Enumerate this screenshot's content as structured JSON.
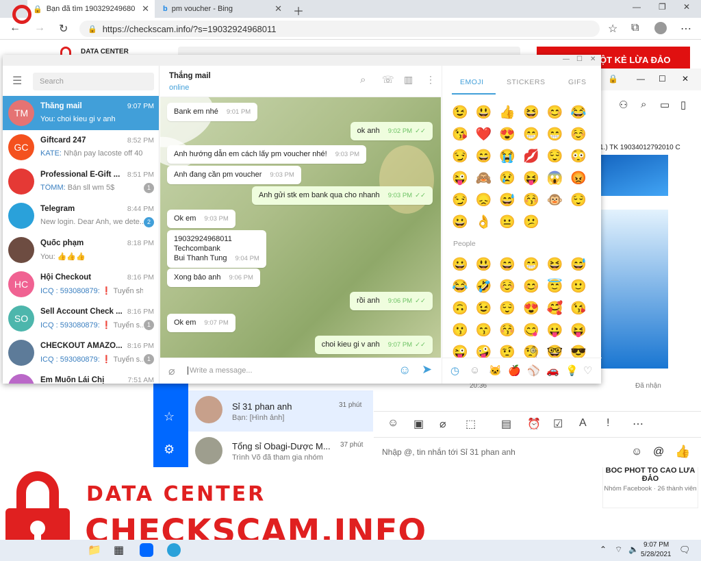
{
  "browser": {
    "tabs": [
      {
        "title": "Bạn đã tìm 19032924968011 - Ch"
      },
      {
        "title": "pm voucher - Bing"
      }
    ],
    "url": "https://checkscam.info/?s=19032924968011"
  },
  "site": {
    "brand_small": "DATA CENTER",
    "red_banner": "ỘT KẺ LỪA ĐẢO",
    "card_title": "BÓC PHỐT TỐ CÁO LỪA ĐẢO",
    "card_sub": "Nhóm Facebook · 26 thành viên",
    "logo_line1": "DATA CENTER",
    "logo_line2": "CHECKSCAM.INFO"
  },
  "telegram": {
    "search_placeholder": "Search",
    "chats": [
      {
        "name": "Thắng mail",
        "time": "9:07 PM",
        "preview": "You: choi kieu gi v anh",
        "initials": "TM",
        "color": "#e57373",
        "selected": true
      },
      {
        "name": "Giftcard 247",
        "time": "8:52 PM",
        "preview_sender": "KATE:",
        "preview": "Nhận pay lacoste off 40",
        "initials": "GC",
        "color": "#f4511e"
      },
      {
        "name": "Professional E-Gift ...",
        "time": "8:51 PM",
        "preview_sender": "TÔMM:",
        "preview": "Bán sll wm 5$",
        "initials": "",
        "color": "#e53935",
        "badge": "1"
      },
      {
        "name": "Telegram",
        "time": "8:44 PM",
        "preview": "New login. Dear Anh, we dete...",
        "initials": "",
        "color": "#2aa1da",
        "badge": "2"
      },
      {
        "name": "Quốc phạm",
        "time": "8:18 PM",
        "preview": "You: 👍👍👍",
        "initials": "",
        "color": "#6d4c41"
      },
      {
        "name": "Hội Checkout",
        "time": "8:16 PM",
        "preview_sender": "ICQ : 593080879:",
        "preview": "❗ Tuyển shipp...",
        "initials": "HC",
        "color": "#f06292"
      },
      {
        "name": "Sell Account Check ...",
        "time": "8:16 PM",
        "preview_sender": "ICQ : 593080879:",
        "preview": "❗ Tuyển s...",
        "initials": "SO",
        "color": "#4db6ac",
        "badge": "1"
      },
      {
        "name": "CHECKOUT AMAZO...",
        "time": "8:16 PM",
        "preview_sender": "ICQ : 593080879:",
        "preview": "❗ Tuyển s...",
        "initials": "",
        "color": "#5d7b99",
        "badge": "1"
      },
      {
        "name": "Em Muốn Lái Chị",
        "time": "7:51 AM",
        "preview": "",
        "initials": "EC",
        "color": "#ba68c8"
      }
    ],
    "header": {
      "name": "Thắng mail",
      "status": "online"
    },
    "messages": [
      {
        "text": "Bank em nhé",
        "time": "9:01 PM",
        "out": false
      },
      {
        "text": "ok anh",
        "time": "9:02 PM",
        "out": true
      },
      {
        "text": "Anh hướng dẫn em cách lấy pm voucher nhé!",
        "time": "9:03 PM",
        "out": false
      },
      {
        "text": "Anh đang cần pm voucher",
        "time": "9:03 PM",
        "out": false
      },
      {
        "text": "Anh gửi stk em bank qua cho nhanh",
        "time": "9:03 PM",
        "out": true
      },
      {
        "text": "Ok em",
        "time": "9:03 PM",
        "out": false
      },
      {
        "text": "19032924968011\nTechcombank\nBui Thanh Tung",
        "time": "9:04 PM",
        "out": false
      },
      {
        "text": "Xong bảo anh",
        "time": "9:06 PM",
        "out": false
      },
      {
        "text": "rồi anh",
        "time": "9:06 PM",
        "out": true
      },
      {
        "text": "Ok em",
        "time": "9:07 PM",
        "out": false
      },
      {
        "text": "choi kieu gi v anh",
        "time": "9:07 PM",
        "out": true
      }
    ],
    "composer_placeholder": "Write a message...",
    "emoji_tabs": [
      "EMOJI",
      "STICKERS",
      "GIFS"
    ],
    "emoji_section": "People",
    "emoji_rows": [
      "😉😃👍😆😊😂",
      "😘❤️😍😁😁☺️",
      "😏😄😭💋😌😳",
      "😜🙈😢😝😱😡",
      "😏😞😅😚🐵😌",
      "😀👌😐😕"
    ],
    "people_rows": [
      "😀😃😄😁😆😅",
      "😂🤣☺️😊😇🙂",
      "🙃😉😌😍🥰😘",
      "😗😙😚😋😛😝",
      "😜🤪🤨🧐🤓😎"
    ]
  },
  "zalo": {
    "conversations": [
      {
        "name": "Sỉ 31 phan anh",
        "time": "31 phút",
        "preview": "Bạn: [Hình ảnh]"
      },
      {
        "name": "Tổng sỉ Obagi-Dược M...",
        "time": "37 phút",
        "preview": "Trình Võ đã tham gia nhóm"
      }
    ],
    "group_title": "1.) TK 19034012792010 C",
    "time_label": "20:36",
    "received_label": "Đã nhận",
    "input_placeholder": "Nhập @, tin nhắn tới Sỉ 31 phan anh"
  },
  "taskbar": {
    "time": "9:07 PM",
    "date": "5/28/2021"
  }
}
